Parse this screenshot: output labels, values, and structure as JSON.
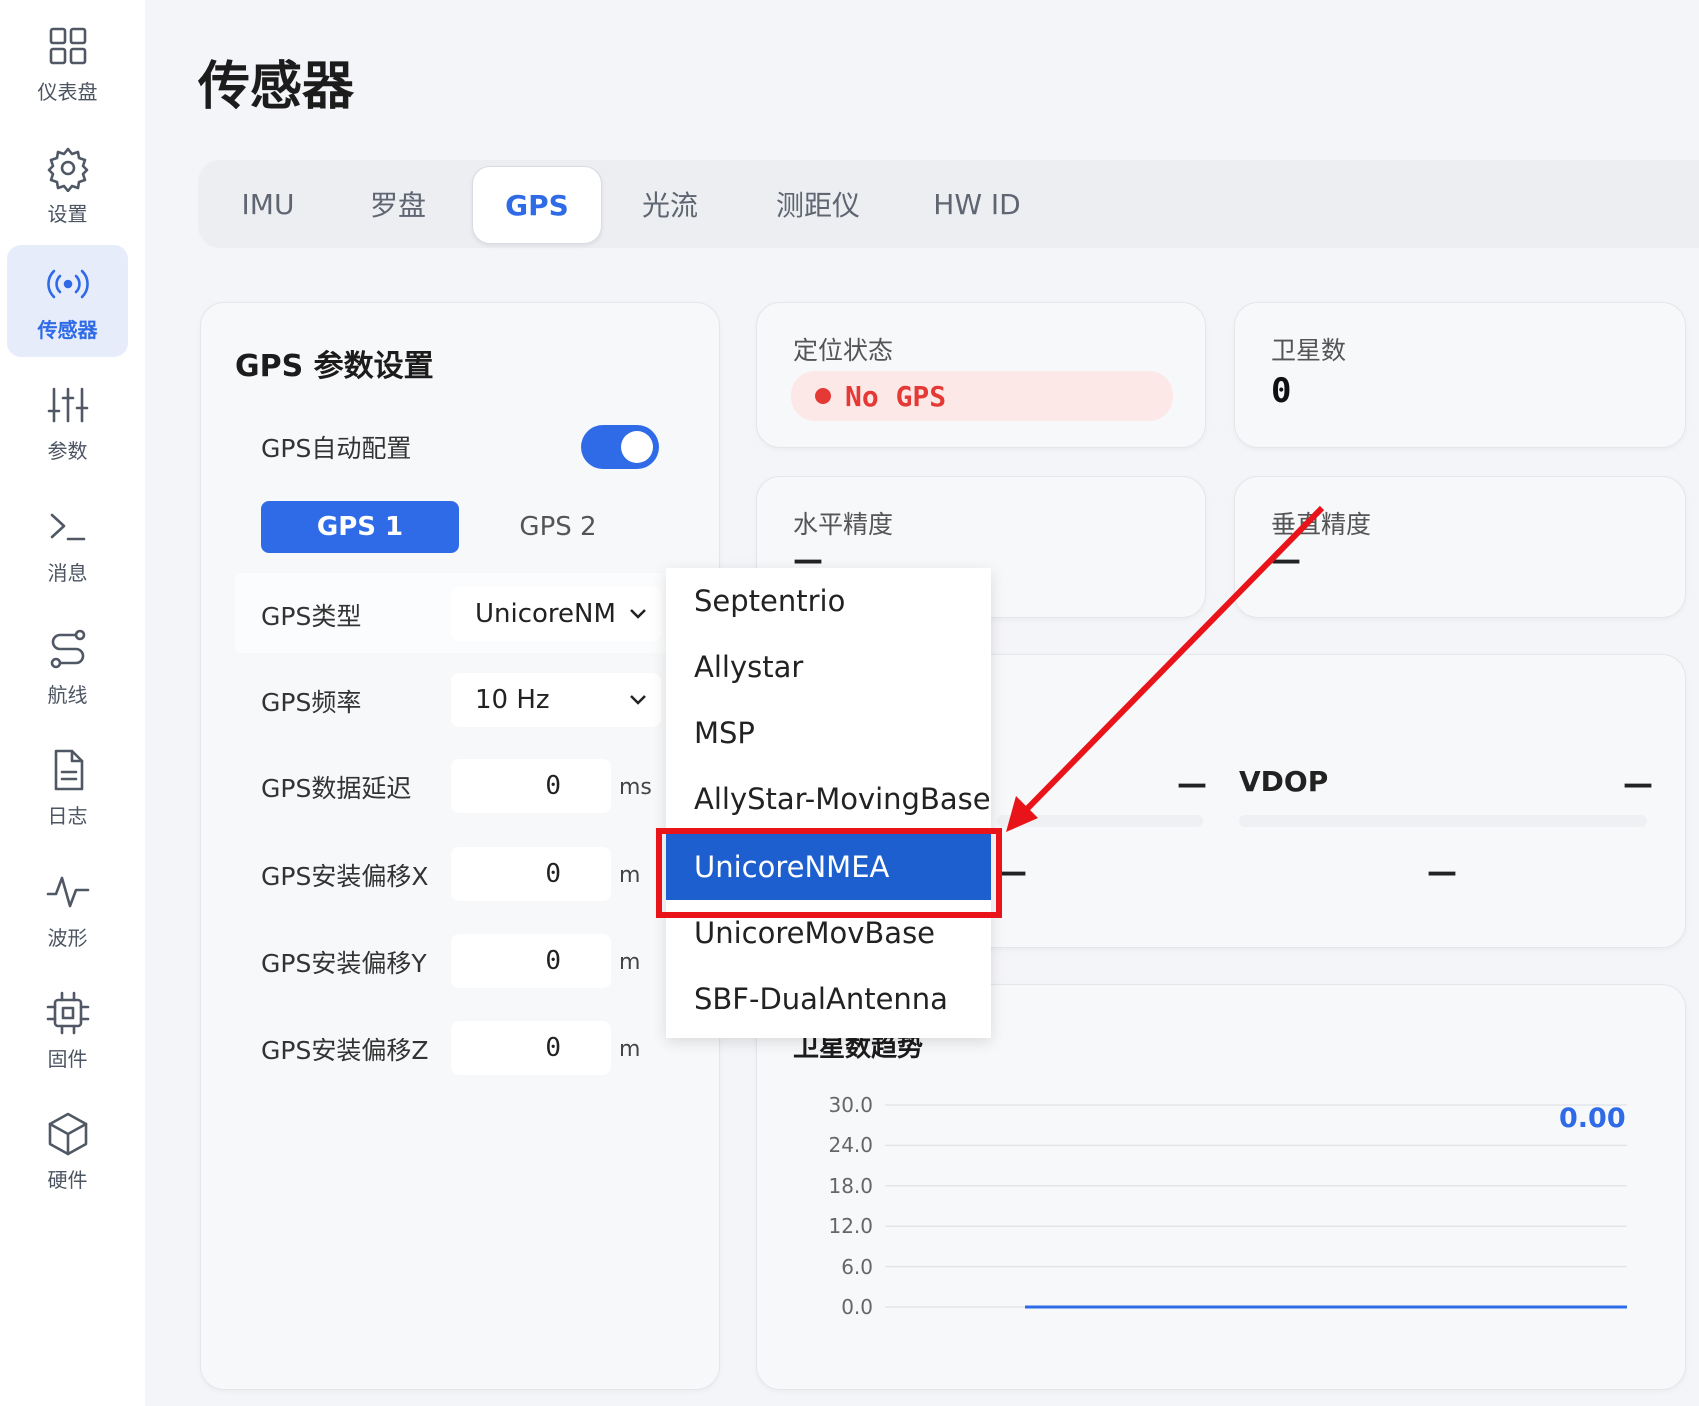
{
  "sidebar": {
    "items": [
      {
        "label": "仪表盘",
        "icon": "dashboard-icon"
      },
      {
        "label": "设置",
        "icon": "gear-icon"
      },
      {
        "label": "传感器",
        "icon": "sensor-icon"
      },
      {
        "label": "参数",
        "icon": "sliders-icon"
      },
      {
        "label": "消息",
        "icon": "terminal-icon"
      },
      {
        "label": "航线",
        "icon": "route-icon"
      },
      {
        "label": "日志",
        "icon": "document-icon"
      },
      {
        "label": "波形",
        "icon": "waveform-icon"
      },
      {
        "label": "固件",
        "icon": "chip-icon"
      },
      {
        "label": "硬件",
        "icon": "cube-icon"
      }
    ],
    "active": "传感器"
  },
  "page": {
    "title": "传感器"
  },
  "tabs": [
    {
      "label": "IMU"
    },
    {
      "label": "罗盘"
    },
    {
      "label": "GPS"
    },
    {
      "label": "光流"
    },
    {
      "label": "测距仪"
    },
    {
      "label": "HW ID"
    }
  ],
  "active_tab": "GPS",
  "gps_settings": {
    "title": "GPS 参数设置",
    "auto_config_label": "GPS自动配置",
    "auto_config_on": true,
    "segments": [
      "GPS 1",
      "GPS 2"
    ],
    "active_segment": "GPS 1",
    "type_label": "GPS类型",
    "type_value": "UnicoreNMEA",
    "rate_label": "GPS频率",
    "rate_value": "10 Hz",
    "delay_label": "GPS数据延迟",
    "delay_value": "0",
    "delay_unit": "ms",
    "offset_x_label": "GPS安装偏移X",
    "offset_x_value": "0",
    "offset_y_label": "GPS安装偏移Y",
    "offset_y_value": "0",
    "offset_z_label": "GPS安装偏移Z",
    "offset_z_value": "0",
    "offset_unit": "m"
  },
  "status": {
    "fix_label": "定位状态",
    "fix_value": "No GPS",
    "fix_color": "#e53935",
    "sat_label": "卫星数",
    "sat_value": "0",
    "hacc_label": "水平精度",
    "hacc_value": "—",
    "vacc_label": "垂直精度",
    "vacc_value": "—",
    "hdop_value": "—",
    "vdop_label": "VDOP",
    "vdop_value": "—",
    "extra_a": "—",
    "extra_b": "—"
  },
  "dropdown": {
    "options": [
      "Septentrio",
      "Allystar",
      "MSP",
      "AllyStar-MovingBase",
      "UnicoreNMEA",
      "UnicoreMovBase",
      "SBF-DualAntenna"
    ],
    "selected": "UnicoreNMEA"
  },
  "chart_data": {
    "type": "line",
    "title": "卫星数趋势",
    "yticks": [
      "30.0",
      "24.0",
      "18.0",
      "12.0",
      "6.0",
      "0.0"
    ],
    "ylim": [
      0,
      30
    ],
    "series": [
      {
        "values": [
          0,
          0
        ]
      }
    ],
    "current_value": "0.00",
    "grid": true
  },
  "colors": {
    "accent": "#2f6be6",
    "highlight": "#e8141a"
  }
}
